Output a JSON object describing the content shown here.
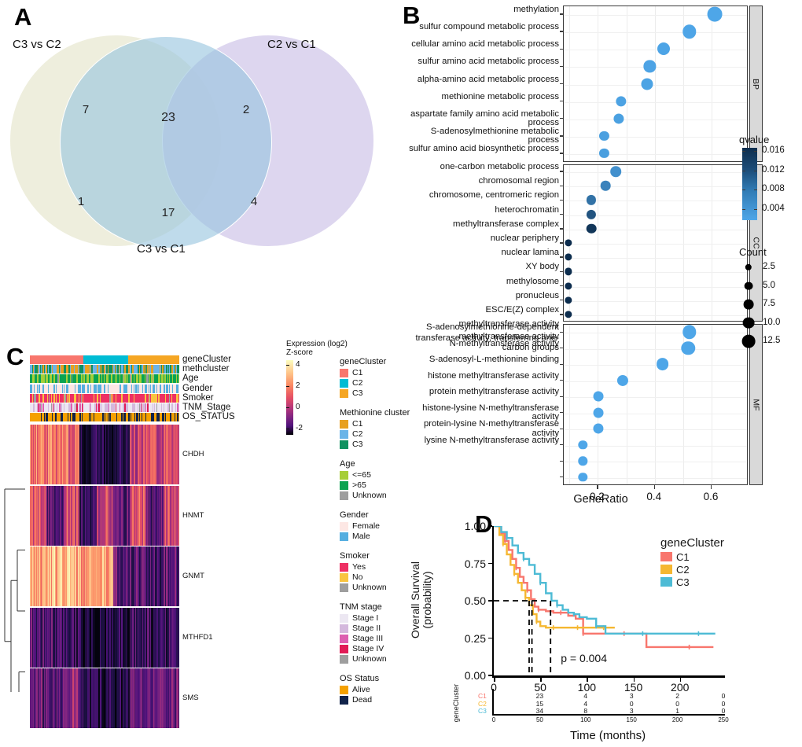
{
  "panels": {
    "a": {
      "letter": "A"
    },
    "b": {
      "letter": "B"
    },
    "c": {
      "letter": "C"
    },
    "d": {
      "letter": "D"
    }
  },
  "venn": {
    "sets": [
      {
        "label": "C3 vs C2",
        "color": "#eeeedd"
      },
      {
        "label": "C2 vs C1",
        "color": "#ddd7ee"
      },
      {
        "label": "C3 vs C1",
        "color": "#b9d4e3"
      }
    ],
    "counts": {
      "only_c3c2": "1",
      "only_c2c1": "4",
      "c3c2_and_c3c1": "7",
      "c2c1_and_c3c1": "2",
      "all_three": "23",
      "c3c2_and_c2c1": "17"
    }
  },
  "chart_data": [
    {
      "type": "scatter",
      "id": "go-dotplot",
      "title": "",
      "xlabel": "GeneRatio",
      "ylabel": "",
      "xlim": [
        0.08,
        0.68
      ],
      "xticks": [
        0.2,
        0.4,
        0.6
      ],
      "xticklabels": [
        "0.2",
        "0.4",
        "0.6"
      ],
      "grid": true,
      "legend_position": "right",
      "facets": [
        {
          "name": "BP",
          "terms": [
            "methylation",
            "sulfur compound metabolic process",
            "cellular amino acid metabolic process",
            "sulfur amino acid metabolic process",
            "alpha-amino acid metabolic process",
            "methionine metabolic process",
            "aspartate family amino acid metabolic process",
            "S-adenosylmethionine metabolic process",
            "sulfur amino acid biosynthetic process"
          ],
          "generatio": [
            0.615,
            0.525,
            0.435,
            0.385,
            0.375,
            0.285,
            0.275,
            0.225,
            0.225
          ],
          "count": [
            13.0,
            11.5,
            10.0,
            9.2,
            9.0,
            7.2,
            7.0,
            6.0,
            6.0
          ],
          "qvalue": [
            0.002,
            0.0021,
            0.0022,
            0.0023,
            0.0024,
            0.0025,
            0.0026,
            0.0027,
            0.0028
          ]
        },
        {
          "name": "CC",
          "terms": [
            "one-carbon metabolic process",
            "chromosomal region",
            "chromosome, centromeric region",
            "heterochromatin",
            "methyltransferase complex",
            "nuclear periphery",
            "nuclear lamina",
            "XY body",
            "methylosome",
            "pronucleus",
            "ESC/E(Z) complex",
            "methyltransferase activity",
            "transferase activity, transferring one-carbon groups"
          ],
          "generatio": [
            0.265,
            0.23,
            0.18,
            0.18,
            0.18,
            0.1,
            0.1,
            0.1,
            0.1,
            0.1,
            0.1
          ],
          "count": [
            7.5,
            6.5,
            6.0,
            6.0,
            6.5,
            3.0,
            3.0,
            3.0,
            3.0,
            3.0,
            3.0
          ],
          "qvalue": [
            0.0045,
            0.006,
            0.008,
            0.0115,
            0.015,
            0.016,
            0.016,
            0.016,
            0.016,
            0.016,
            0.016
          ]
        },
        {
          "name": "MF",
          "terms": [
            "S-adenosylmethionine-dependent methyltransferase activity",
            "N-methyltransferase activity",
            "S-adenosyl-L-methionine binding",
            "histone methyltransferase activity",
            "protein methyltransferase activity",
            "histone-lysine N-methyltransferase activity",
            "protein-lysine N-methyltransferase activity",
            "lysine N-methyltransferase activity"
          ],
          "generatio": [
            0.525,
            0.52,
            0.43,
            0.29,
            0.205,
            0.205,
            0.205,
            0.15,
            0.15,
            0.15
          ],
          "count": [
            11.5,
            11.5,
            9.8,
            8.0,
            6.8,
            6.8,
            7.0,
            5.2,
            5.2,
            5.2
          ],
          "qvalue": [
            0.002,
            0.002,
            0.002,
            0.002,
            0.002,
            0.002,
            0.002,
            0.002,
            0.002,
            0.002
          ]
        }
      ],
      "colorbar": {
        "title": "qvalue",
        "ticks": [
          "0.016",
          "0.012",
          "0.008",
          "0.004"
        ],
        "high_color": "#0d2d4e",
        "low_color": "#4ea6e8"
      },
      "sizelegend": {
        "title": "Count",
        "values": [
          "2.5",
          "5.0",
          "7.5",
          "10.0",
          "12.5"
        ]
      }
    },
    {
      "type": "line",
      "id": "km-survival",
      "title": "",
      "xlabel": "Time (months)",
      "ylabel": "Overall Survival\n(probability)",
      "xlim": [
        0,
        245
      ],
      "ylim": [
        0,
        1
      ],
      "xticks": [
        0,
        50,
        100,
        150,
        200
      ],
      "xticklabels": [
        "0",
        "50",
        "100",
        "150",
        "200"
      ],
      "yticks": [
        0.0,
        0.25,
        0.5,
        0.75,
        1.0
      ],
      "yticklabels": [
        "0.00",
        "0.25",
        "0.50",
        "0.75",
        "1.00"
      ],
      "pvalue": "p = 0.004",
      "median_lines": [
        38,
        41,
        61
      ],
      "legend_title": "geneCluster",
      "series": [
        {
          "name": "C1",
          "color": "#f8766d",
          "x": [
            0,
            8,
            12,
            16,
            20,
            24,
            28,
            32,
            36,
            40,
            44,
            48,
            56,
            64,
            72,
            80,
            88,
            96,
            110,
            120,
            140,
            164,
            180,
            210,
            236
          ],
          "y": [
            1.0,
            0.95,
            0.9,
            0.84,
            0.78,
            0.72,
            0.66,
            0.62,
            0.57,
            0.51,
            0.46,
            0.44,
            0.43,
            0.42,
            0.42,
            0.4,
            0.38,
            0.28,
            0.28,
            0.28,
            0.28,
            0.19,
            0.19,
            0.19,
            0.19
          ]
        },
        {
          "name": "C2",
          "color": "#f5b731",
          "x": [
            0,
            6,
            10,
            14,
            18,
            22,
            26,
            30,
            34,
            38,
            42,
            46,
            50,
            56,
            64,
            72,
            80,
            90,
            100,
            110,
            118,
            130
          ],
          "y": [
            1.0,
            0.94,
            0.88,
            0.81,
            0.74,
            0.68,
            0.62,
            0.57,
            0.52,
            0.47,
            0.41,
            0.36,
            0.33,
            0.32,
            0.32,
            0.32,
            0.32,
            0.32,
            0.32,
            0.32,
            0.32,
            0.32
          ]
        },
        {
          "name": "C3",
          "color": "#4dbbd5",
          "x": [
            0,
            8,
            14,
            20,
            26,
            32,
            38,
            44,
            50,
            56,
            62,
            68,
            74,
            80,
            86,
            92,
            100,
            110,
            120,
            140,
            160,
            180,
            200,
            220,
            238
          ],
          "y": [
            1.0,
            0.96,
            0.92,
            0.87,
            0.82,
            0.78,
            0.74,
            0.68,
            0.62,
            0.55,
            0.5,
            0.47,
            0.44,
            0.42,
            0.41,
            0.39,
            0.38,
            0.33,
            0.28,
            0.28,
            0.28,
            0.28,
            0.28,
            0.28,
            0.28
          ]
        }
      ],
      "risk_table": {
        "row_title": "geneCluster",
        "times": [
          "0",
          "50",
          "100",
          "150",
          "200",
          "250"
        ],
        "rows": [
          {
            "name": "C1",
            "color": "#f8766d",
            "counts": [
              "",
              "23",
              "4",
              "3",
              "2",
              "0"
            ]
          },
          {
            "name": "C2",
            "color": "#f5b731",
            "counts": [
              "",
              "15",
              "4",
              "0",
              "0",
              "0"
            ]
          },
          {
            "name": "C3",
            "color": "#4dbbd5",
            "counts": [
              "",
              "34",
              "8",
              "3",
              "1",
              "0"
            ]
          }
        ]
      }
    }
  ],
  "heatmap": {
    "annotation_rows": [
      {
        "name": "geneCluster"
      },
      {
        "name": "methcluster"
      },
      {
        "name": "Age"
      },
      {
        "name": "Gender"
      },
      {
        "name": "Smoker"
      },
      {
        "name": "TNM_Stage"
      },
      {
        "name": "OS_STATUS"
      }
    ],
    "genes": [
      "CHDH",
      "HNMT",
      "GNMT",
      "MTHFD1",
      "SMS"
    ],
    "colorbar": {
      "title_line1": "Expression (log2)",
      "title_line2": "Z-score",
      "ticks": [
        "4",
        "2",
        "0",
        "-2"
      ]
    },
    "legends": [
      {
        "title": "geneCluster",
        "items": [
          {
            "label": "C1",
            "color": "#f8766d"
          },
          {
            "label": "C2",
            "color": "#00bcd4"
          },
          {
            "label": "C3",
            "color": "#f5a623"
          }
        ]
      },
      {
        "title": "Methionine cluster",
        "items": [
          {
            "label": "C1",
            "color": "#e8a020"
          },
          {
            "label": "C2",
            "color": "#6ab4e8"
          },
          {
            "label": "C3",
            "color": "#109160"
          }
        ]
      },
      {
        "title": "Age",
        "items": [
          {
            "label": "<=65",
            "color": "#a6ce39"
          },
          {
            "label": ">65",
            "color": "#0aa350"
          },
          {
            "label": "Unknown",
            "color": "#9e9e9e"
          }
        ]
      },
      {
        "title": "Gender",
        "items": [
          {
            "label": "Female",
            "color": "#fde7e4"
          },
          {
            "label": "Male",
            "color": "#55aee0"
          }
        ]
      },
      {
        "title": "Smoker",
        "items": [
          {
            "label": "Yes",
            "color": "#ee2f63"
          },
          {
            "label": "No",
            "color": "#f9c440"
          },
          {
            "label": "Unknown",
            "color": "#9e9e9e"
          }
        ]
      },
      {
        "title": "TNM stage",
        "items": [
          {
            "label": "Stage I",
            "color": "#ece7f2"
          },
          {
            "label": "Stage II",
            "color": "#d4b8dd"
          },
          {
            "label": "Stage III",
            "color": "#dd5fb0"
          },
          {
            "label": "Stage IV",
            "color": "#e11b56"
          },
          {
            "label": "Unknown",
            "color": "#9e9e9e"
          }
        ]
      },
      {
        "title": "OS Status",
        "items": [
          {
            "label": "Alive",
            "color": "#f5a100"
          },
          {
            "label": "Dead",
            "color": "#11234a"
          }
        ]
      }
    ]
  }
}
